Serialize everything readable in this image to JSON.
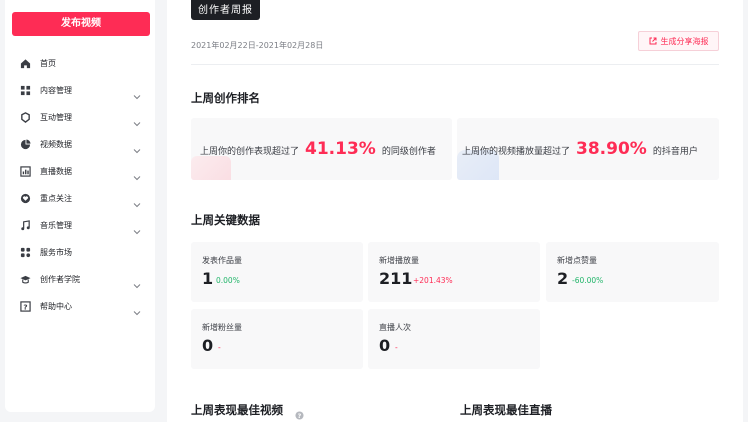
{
  "sidebar": {
    "publish_label": "发布视频",
    "items": [
      {
        "label": "首页",
        "icon": "home-icon",
        "expandable": false
      },
      {
        "label": "内容管理",
        "icon": "content-icon",
        "expandable": true
      },
      {
        "label": "互动管理",
        "icon": "interact-icon",
        "expandable": true
      },
      {
        "label": "视频数据",
        "icon": "pie-chart-icon",
        "expandable": true
      },
      {
        "label": "直播数据",
        "icon": "bar-chart-icon",
        "expandable": true
      },
      {
        "label": "重点关注",
        "icon": "heart-icon",
        "expandable": true
      },
      {
        "label": "音乐管理",
        "icon": "music-icon",
        "expandable": true
      },
      {
        "label": "服务市场",
        "icon": "grid-icon",
        "expandable": false
      },
      {
        "label": "创作者学院",
        "icon": "graduation-icon",
        "expandable": true
      },
      {
        "label": "帮助中心",
        "icon": "help-icon",
        "expandable": true
      }
    ]
  },
  "report": {
    "badge": "创作者周报",
    "date_range": "2021年02月22日-2021年02月28日",
    "share_label": "生成分享海报"
  },
  "ranking": {
    "title": "上周创作排名",
    "cards": [
      {
        "prefix": "上周你的创作表现超过了",
        "value": "41.13%",
        "suffix": "的同级创作者"
      },
      {
        "prefix": "上周你的视频播放量超过了",
        "value": "38.90%",
        "suffix": "的抖音用户"
      }
    ]
  },
  "key_data": {
    "title": "上周关键数据",
    "metrics": [
      {
        "label": "发表作品量",
        "value": "1",
        "delta": "0.00%",
        "trend": "flat"
      },
      {
        "label": "新增播放量",
        "value": "211",
        "delta": "+201.43%",
        "trend": "up"
      },
      {
        "label": "新增点赞量",
        "value": "2",
        "delta": "-60.00%",
        "trend": "down"
      },
      {
        "label": "新增粉丝量",
        "value": "0",
        "delta": "-",
        "trend": "none"
      },
      {
        "label": "直播人次",
        "value": "0",
        "delta": "-",
        "trend": "none"
      }
    ]
  },
  "best": {
    "video_title": "上周表现最佳视频",
    "live_title": "上周表现最佳直播"
  },
  "colors": {
    "accent": "#fe2c55",
    "positive": "#22b56a"
  }
}
